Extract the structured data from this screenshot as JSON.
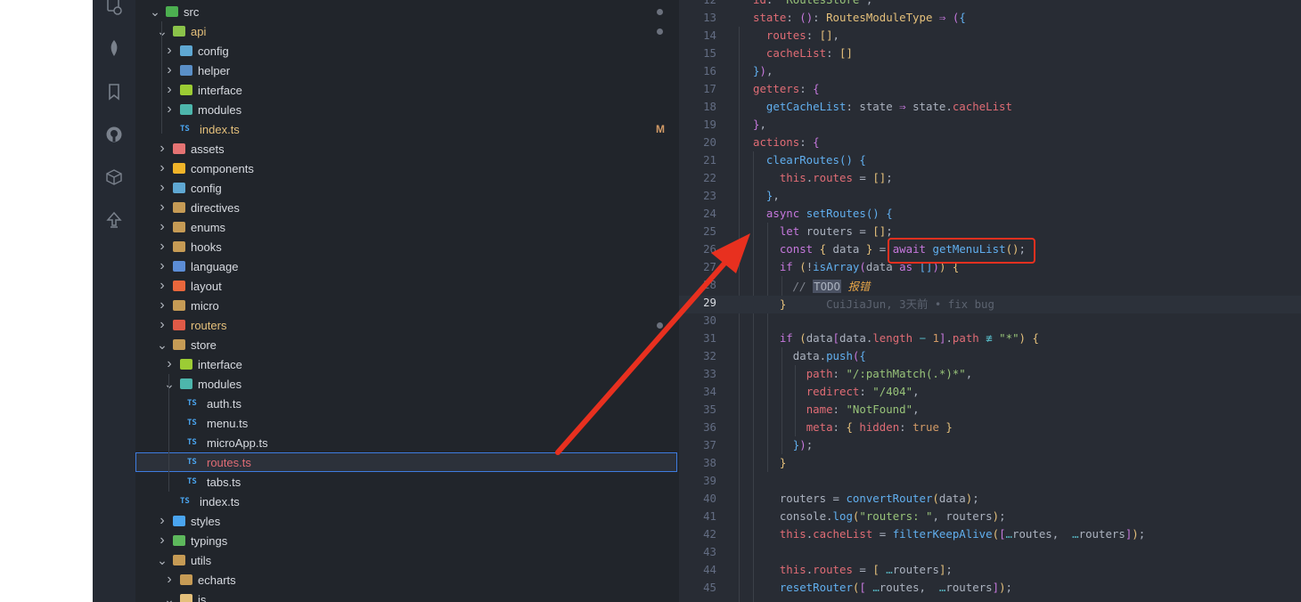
{
  "activity_bar": {
    "icons": [
      "remote-explorer-icon",
      "mongodb-leaf-icon",
      "bookmark-icon",
      "github-icon",
      "package-icon",
      "tree-icon"
    ]
  },
  "explorer": {
    "items": [
      {
        "label": "src",
        "level": 0,
        "type": "folder",
        "open": true,
        "icon_color": "#4caf50",
        "dot": true
      },
      {
        "label": "api",
        "level": 1,
        "type": "folder",
        "open": true,
        "icon_color": "#8bc34a",
        "status": "modified",
        "dot": true
      },
      {
        "label": "config",
        "level": 2,
        "type": "folder",
        "open": false,
        "icon_color": "#5fa8d3"
      },
      {
        "label": "helper",
        "level": 2,
        "type": "folder",
        "open": false,
        "icon_color": "#5a8fc7"
      },
      {
        "label": "interface",
        "level": 2,
        "type": "folder",
        "open": false,
        "icon_color": "#9ccc34"
      },
      {
        "label": "modules",
        "level": 2,
        "type": "folder",
        "open": false,
        "icon_color": "#4db6ac"
      },
      {
        "label": "index.ts",
        "level": 2,
        "type": "ts",
        "status": "modified",
        "badge": "M"
      },
      {
        "label": "assets",
        "level": 1,
        "type": "folder",
        "open": false,
        "icon_color": "#e57373"
      },
      {
        "label": "components",
        "level": 1,
        "type": "folder",
        "open": false,
        "icon_color": "#f0b429"
      },
      {
        "label": "config",
        "level": 1,
        "type": "folder",
        "open": false,
        "icon_color": "#5fa8d3"
      },
      {
        "label": "directives",
        "level": 1,
        "type": "folder",
        "open": false,
        "icon_color": "#c69b55"
      },
      {
        "label": "enums",
        "level": 1,
        "type": "folder",
        "open": false,
        "icon_color": "#c69b55"
      },
      {
        "label": "hooks",
        "level": 1,
        "type": "folder",
        "open": false,
        "icon_color": "#c69b55"
      },
      {
        "label": "language",
        "level": 1,
        "type": "folder",
        "open": false,
        "icon_color": "#5c8dd6"
      },
      {
        "label": "layout",
        "level": 1,
        "type": "folder",
        "open": false,
        "icon_color": "#e9673c"
      },
      {
        "label": "micro",
        "level": 1,
        "type": "folder",
        "open": false,
        "icon_color": "#c69b55"
      },
      {
        "label": "routers",
        "level": 1,
        "type": "folder",
        "open": false,
        "icon_color": "#e05a47",
        "status": "modified",
        "dot": true
      },
      {
        "label": "store",
        "level": 1,
        "type": "folder",
        "open": true,
        "icon_color": "#c69b55"
      },
      {
        "label": "interface",
        "level": 2,
        "type": "folder",
        "open": false,
        "icon_color": "#9ccc34"
      },
      {
        "label": "modules",
        "level": 2,
        "type": "folder",
        "open": true,
        "icon_color": "#4db6ac"
      },
      {
        "label": "auth.ts",
        "level": 3,
        "type": "ts"
      },
      {
        "label": "menu.ts",
        "level": 3,
        "type": "ts"
      },
      {
        "label": "microApp.ts",
        "level": 3,
        "type": "ts"
      },
      {
        "label": "routes.ts",
        "level": 3,
        "type": "ts",
        "status": "deleted",
        "selected": true
      },
      {
        "label": "tabs.ts",
        "level": 3,
        "type": "ts"
      },
      {
        "label": "index.ts",
        "level": 2,
        "type": "ts"
      },
      {
        "label": "styles",
        "level": 1,
        "type": "folder",
        "open": false,
        "icon_color": "#4aa5f0"
      },
      {
        "label": "typings",
        "level": 1,
        "type": "folder",
        "open": false,
        "icon_color": "#5db85c"
      },
      {
        "label": "utils",
        "level": 1,
        "type": "folder",
        "open": true,
        "icon_color": "#c69b55"
      },
      {
        "label": "echarts",
        "level": 2,
        "type": "folder",
        "open": false,
        "icon_color": "#c69b55"
      },
      {
        "label": "js",
        "level": 2,
        "type": "folder",
        "open": true,
        "icon_color": "#e5c07b"
      }
    ]
  },
  "editor": {
    "current_line": 29,
    "lines": [
      {
        "n": "12",
        "html": "<span class=\"p\">id</span>: <span class=\"s\">\"RoutesStore\"</span>,"
      },
      {
        "n": "13",
        "html": "<span class=\"p\">state</span>: <span class=\"br2\">()</span>: <span class=\"t\">RoutesModuleType</span> <span class=\"k\">⇒</span> <span class=\"br2\">(</span><span class=\"br3\">{</span>"
      },
      {
        "n": "14",
        "html": "  <span class=\"p\">routes</span>: <span class=\"br1\">[]</span>,"
      },
      {
        "n": "15",
        "html": "  <span class=\"p\">cacheList</span>: <span class=\"br1\">[]</span>"
      },
      {
        "n": "16",
        "html": "<span class=\"br3\">}</span><span class=\"br2\">)</span>,"
      },
      {
        "n": "17",
        "html": "<span class=\"p\">getters</span>: <span class=\"br2\">{</span>"
      },
      {
        "n": "18",
        "html": "  <span class=\"f\">getCacheList</span>: state <span class=\"k\">⇒</span> state.<span class=\"p\">cacheList</span>"
      },
      {
        "n": "19",
        "html": "<span class=\"br2\">}</span>,"
      },
      {
        "n": "20",
        "html": "<span class=\"p\">actions</span>: <span class=\"br2\">{</span>"
      },
      {
        "n": "21",
        "html": "  <span class=\"f\">clearRoutes</span><span class=\"br3\">()</span> <span class=\"br3\">{</span>"
      },
      {
        "n": "22",
        "html": "    <span class=\"p\">this</span>.<span class=\"p\">routes</span> = <span class=\"br1\">[]</span>;"
      },
      {
        "n": "23",
        "html": "  <span class=\"br3\">}</span>,"
      },
      {
        "n": "24",
        "html": "  <span class=\"k\">async</span> <span class=\"f\">setRoutes</span><span class=\"br3\">()</span> <span class=\"br3\">{</span>"
      },
      {
        "n": "25",
        "html": "    <span class=\"k\">let</span> routers = <span class=\"br1\">[]</span>;"
      },
      {
        "n": "26",
        "html": "    <span class=\"k\">const</span> <span class=\"br1\">{</span> data <span class=\"br1\">}</span> = <span class=\"k\">await</span> <span class=\"f\">getMenuList</span><span class=\"br1\">()</span>;"
      },
      {
        "n": "27",
        "html": "    <span class=\"k\">if</span> <span class=\"br1\">(</span>!<span class=\"f\">isArray</span><span class=\"br2\">(</span>data <span class=\"k\">as</span> <span class=\"br3\">[]</span><span class=\"br2\">)</span><span class=\"br1\">)</span> <span class=\"br1\">{</span>"
      },
      {
        "n": "28",
        "html": "      <span class=\"c\">// <span class=\"todo\">TODO</span> <span class=\"cmt2\">报错</span></span>"
      },
      {
        "n": "29",
        "html": "    <span class=\"br1\">}</span>      <span class=\"blame\">CuiJiaJun, 3天前 • fix bug</span>"
      },
      {
        "n": "30",
        "html": ""
      },
      {
        "n": "31",
        "html": "    <span class=\"k\">if</span> <span class=\"br1\">(</span>data<span class=\"br2\">[</span>data.<span class=\"p\">length</span> <span class=\"o\">−</span> <span class=\"n\">1</span><span class=\"br2\">]</span>.<span class=\"p\">path</span> <span class=\"o\">≢</span> <span class=\"s\">\"*\"</span><span class=\"br1\">)</span> <span class=\"br1\">{</span>"
      },
      {
        "n": "32",
        "html": "      data.<span class=\"f\">push</span><span class=\"br2\">(</span><span class=\"br3\">{</span>"
      },
      {
        "n": "33",
        "html": "        <span class=\"p\">path</span>: <span class=\"s\">\"/:pathMatch(.*)*\"</span>,"
      },
      {
        "n": "34",
        "html": "        <span class=\"p\">redirect</span>: <span class=\"s\">\"/404\"</span>,"
      },
      {
        "n": "35",
        "html": "        <span class=\"p\">name</span>: <span class=\"s\">\"NotFound\"</span>,"
      },
      {
        "n": "36",
        "html": "        <span class=\"p\">meta</span>: <span class=\"br1\">{</span> <span class=\"p\">hidden</span>: <span class=\"n\">true</span> <span class=\"br1\">}</span>"
      },
      {
        "n": "37",
        "html": "      <span class=\"br3\">}</span><span class=\"br2\">)</span>;"
      },
      {
        "n": "38",
        "html": "    <span class=\"br1\">}</span>"
      },
      {
        "n": "39",
        "html": ""
      },
      {
        "n": "40",
        "html": "    routers = <span class=\"f\">convertRouter</span><span class=\"br1\">(</span>data<span class=\"br1\">)</span>;"
      },
      {
        "n": "41",
        "html": "    console.<span class=\"f\">log</span><span class=\"br1\">(</span><span class=\"s\">\"routers: \"</span>, routers<span class=\"br1\">)</span>;"
      },
      {
        "n": "42",
        "html": "    <span class=\"p\">this</span>.<span class=\"p\">cacheList</span> = <span class=\"f\">filterKeepAlive</span><span class=\"br1\">(</span><span class=\"br2\">[</span><span class=\"o\">…</span>routes,  <span class=\"o\">…</span>routers<span class=\"br2\">]</span><span class=\"br1\">)</span>;"
      },
      {
        "n": "43",
        "html": ""
      },
      {
        "n": "44",
        "html": "    <span class=\"p\">this</span>.<span class=\"p\">routes</span> = <span class=\"br1\">[</span> <span class=\"o\">…</span>routers<span class=\"br1\">]</span>;"
      },
      {
        "n": "45",
        "html": "    <span class=\"f\">resetRouter</span><span class=\"br1\">(</span><span class=\"br2\">[</span> <span class=\"o\">…</span>routes,  <span class=\"o\">…</span>routers<span class=\"br2\">]</span><span class=\"br1\">)</span>;"
      }
    ]
  },
  "annotation": {
    "color": "#e8301f",
    "target": "await getMenuList()"
  }
}
